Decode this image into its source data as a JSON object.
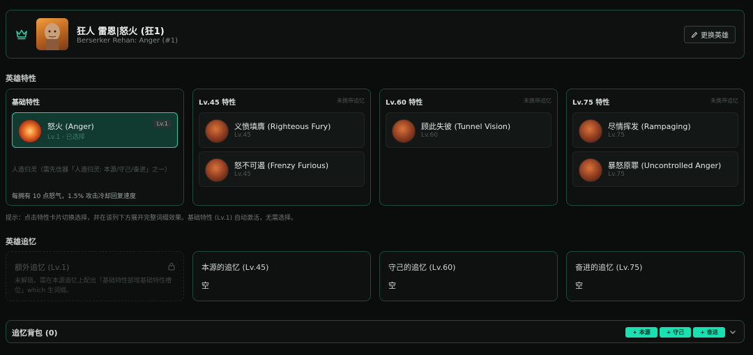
{
  "header": {
    "hero_name": "狂人 雷恩|怒火 (狂1)",
    "hero_subtitle": "Berserker Rehan: Anger (#1)",
    "change_label": "更换英雄",
    "crown_icon": "crown-icon",
    "accent": "#2fc9a2"
  },
  "traits": {
    "section_title": "英雄特性",
    "columns": [
      {
        "title": "基础特性",
        "note": "",
        "cards": [
          {
            "name": "怒火 (Anger)",
            "sub": "Lv.1 · 已选择",
            "badge": "Lv.1",
            "selected": true
          }
        ],
        "desc1": "人造归灵（需先信器「人造归灵: 本源/守己/奋进」之一）",
        "desc2": "每拥有 10 点怒气，1.5% 攻击冷却回复速度"
      },
      {
        "title": "Lv.45 特性",
        "note": "未携带追忆",
        "cards": [
          {
            "name": "义愤填膺 (Righteous Fury)",
            "sub": "Lv.45"
          },
          {
            "name": "怒不可遏 (Frenzy Furious)",
            "sub": "Lv.45"
          }
        ]
      },
      {
        "title": "Lv.60 特性",
        "note": "未携带追忆",
        "cards": [
          {
            "name": "顾此失彼 (Tunnel Vision)",
            "sub": "Lv.60"
          }
        ]
      },
      {
        "title": "Lv.75 特性",
        "note": "未携带追忆",
        "cards": [
          {
            "name": "尽情挥发 (Rampaging)",
            "sub": "Lv.75"
          },
          {
            "name": "暴怒原罪 (Uncontrolled Anger)",
            "sub": "Lv.75"
          }
        ]
      }
    ],
    "tip": "提示：点击特性卡片切换选择，并在该列下方展开完整词缀效果。基础特性 (Lv.1) 自动激活，无需选择。"
  },
  "memories": {
    "section_title": "英雄追忆",
    "cards": [
      {
        "title": "额外追忆 (Lv.1)",
        "locked": true,
        "desc": "未解锁。需在本源追忆上配出「基础特性部增基础特性槽位」which 生词缀。"
      },
      {
        "title": "本源的追忆 (Lv.45)",
        "value": "空"
      },
      {
        "title": "守己的追忆 (Lv.60)",
        "value": "空"
      },
      {
        "title": "奋进的追忆 (Lv.75)",
        "value": "空"
      }
    ]
  },
  "backpack": {
    "title": "追忆背包 (0)",
    "buttons": [
      "+ 本源",
      "+ 守己",
      "+ 奋进"
    ]
  }
}
